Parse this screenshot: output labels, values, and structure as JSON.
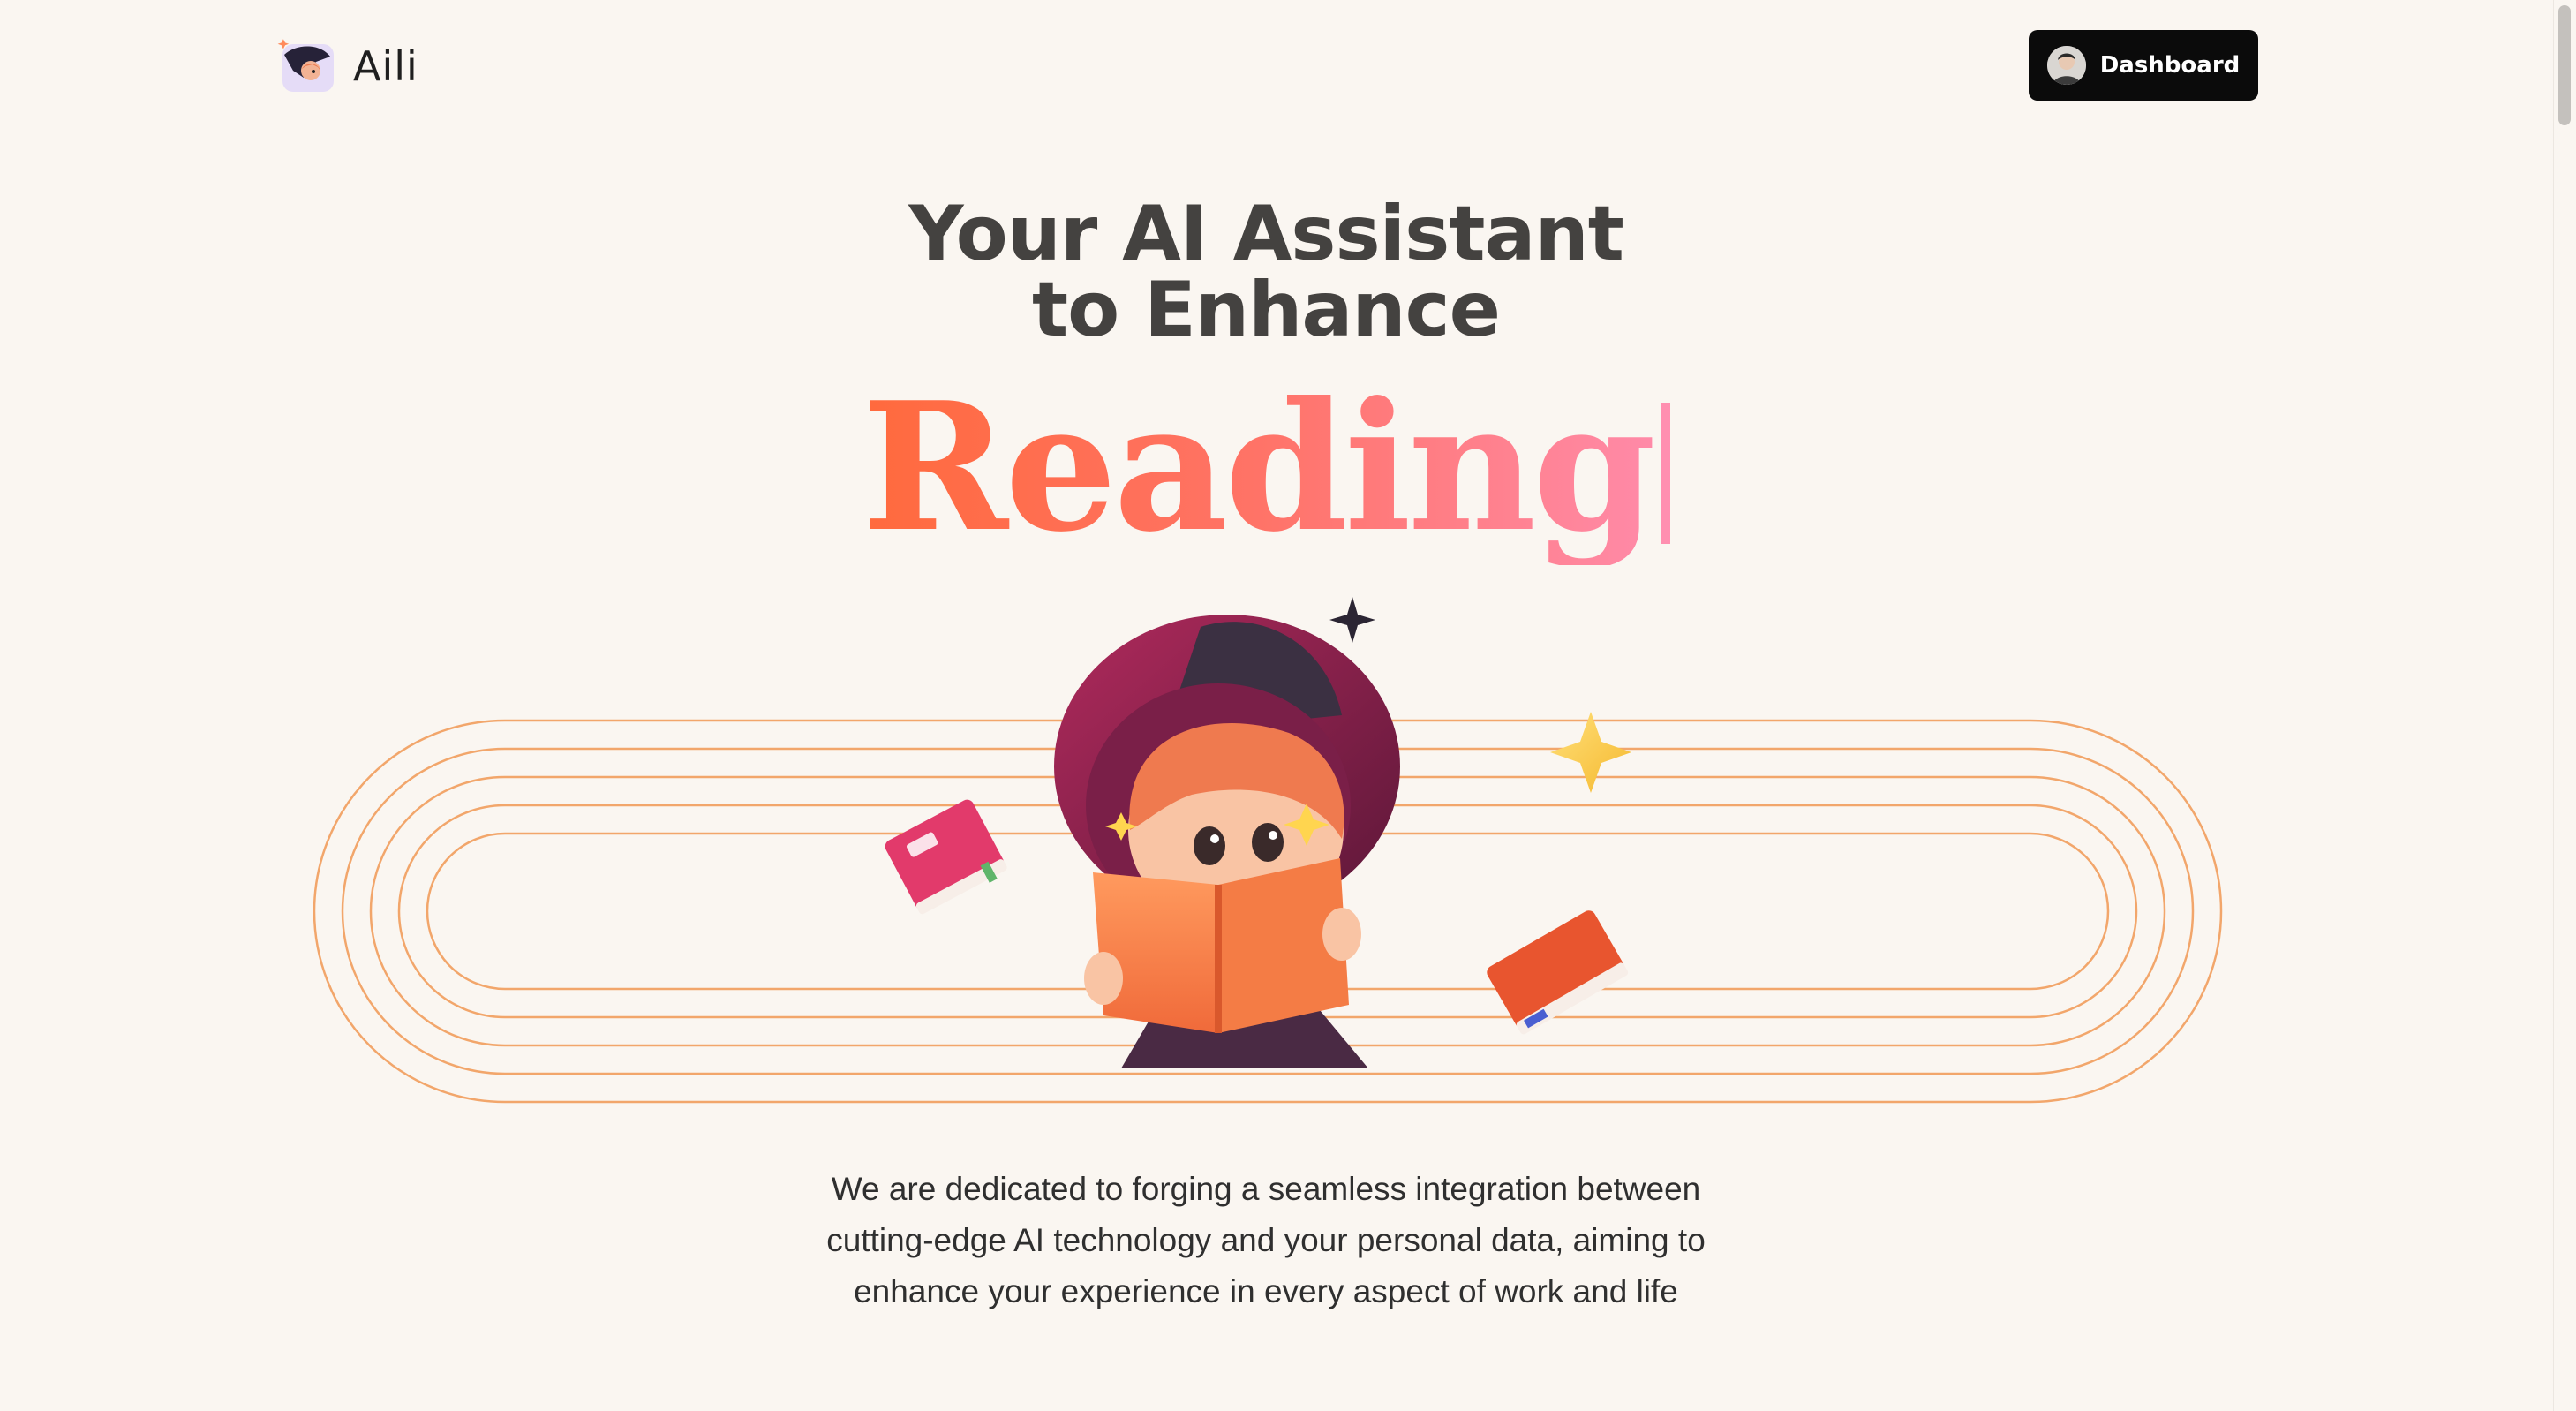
{
  "brand": {
    "name": "Aili",
    "logo_icon": "witch-mascot-icon"
  },
  "nav": {
    "dashboard_label": "Dashboard",
    "avatar_icon": "user-avatar-icon"
  },
  "hero": {
    "title_line1": "Your AI Assistant",
    "title_line2": "to Enhance",
    "keyword": "Reading",
    "illustration": {
      "icon": "girl-reading-book-illustration",
      "decorations": [
        "sparkle-star-icon",
        "book-icon",
        "book-icon",
        "star-icon"
      ],
      "colors": {
        "track_lines": "#f2a66b",
        "keyword_start": "#ff6a3d",
        "keyword_end": "#ff8aa8"
      }
    }
  },
  "description": {
    "line1": "We are dedicated to forging a seamless integration between",
    "line2": "cutting-edge AI technology and your personal data, aiming to",
    "line3": "enhance your experience in every aspect of work and life"
  }
}
